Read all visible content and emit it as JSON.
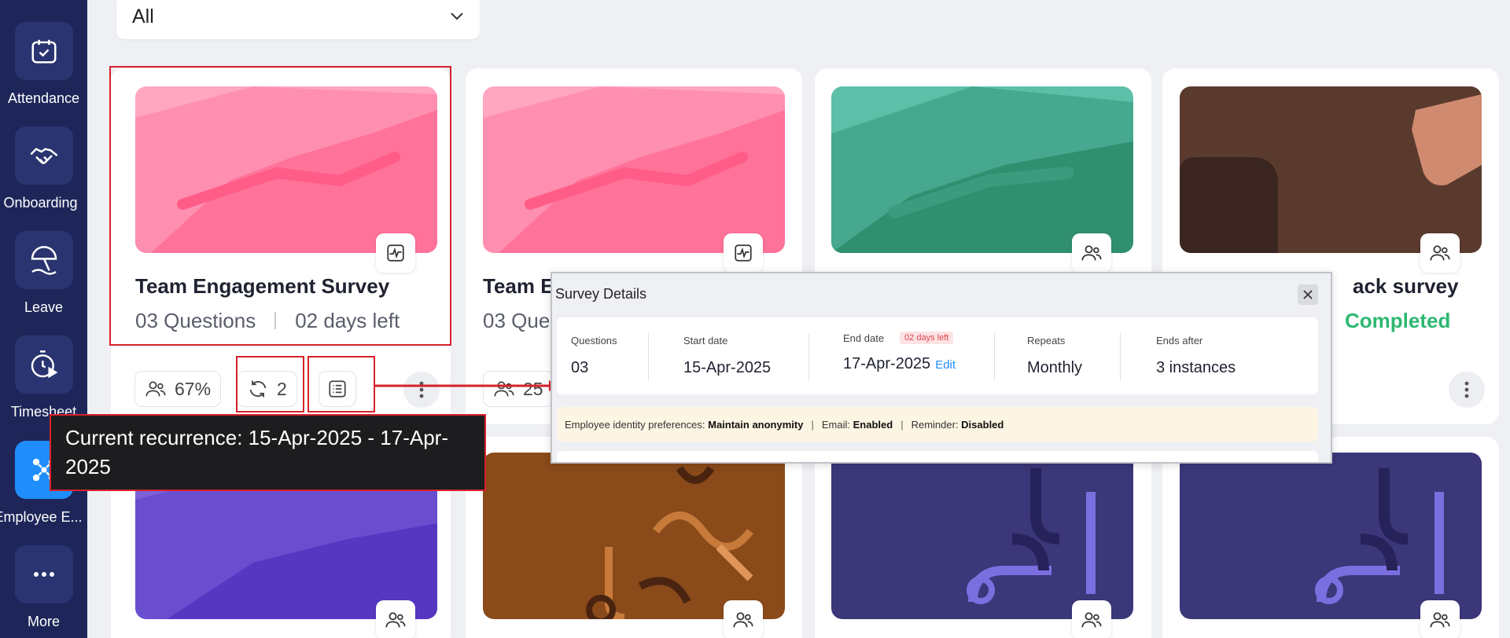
{
  "sidebar": {
    "items": [
      {
        "label": "Attendance",
        "icon": "calendar-check-icon"
      },
      {
        "label": "Onboarding",
        "icon": "handshake-icon"
      },
      {
        "label": "Leave",
        "icon": "beach-umbrella-icon"
      },
      {
        "label": "Timesheet",
        "icon": "timer-icon"
      },
      {
        "label": "Employee E...",
        "icon": "engagement-icon"
      },
      {
        "label": "More",
        "icon": "more-dots-icon"
      }
    ]
  },
  "filter": {
    "value": "All"
  },
  "cards": [
    {
      "title": "Team Engagement Survey",
      "questions": "03 Questions",
      "time_left": "02 days left",
      "participation": "67%",
      "recurrence": "2"
    },
    {
      "title": "Team E",
      "questions": "03 Que",
      "participation": "25"
    },
    {
      "title": "",
      "questions": ""
    },
    {
      "title": "ack survey",
      "status": "Completed"
    }
  ],
  "tooltip": {
    "text": "Current recurrence: 15-Apr-2025 - 17-Apr-2025"
  },
  "popup": {
    "title": "Survey Details",
    "columns": [
      {
        "label": "Questions",
        "value": "03"
      },
      {
        "label": "Start date",
        "value": "15-Apr-2025"
      },
      {
        "label": "End date",
        "value": "17-Apr-2025",
        "tag": "02 days left",
        "edit": "Edit"
      },
      {
        "label": "Repeats",
        "value": "Monthly"
      },
      {
        "label": "Ends after",
        "value": "3 instances"
      }
    ],
    "prefs": {
      "identity_label": "Employee identity preferences:",
      "identity_value": "Maintain anonymity",
      "email_label": "Email:",
      "email_value": "Enabled",
      "reminder_label": "Reminder:",
      "reminder_value": "Disabled"
    }
  },
  "colors": {
    "sidebar": "#1e2659",
    "accent": "#1f8efa",
    "completed": "#2eb872",
    "annotation": "#d6212b"
  }
}
